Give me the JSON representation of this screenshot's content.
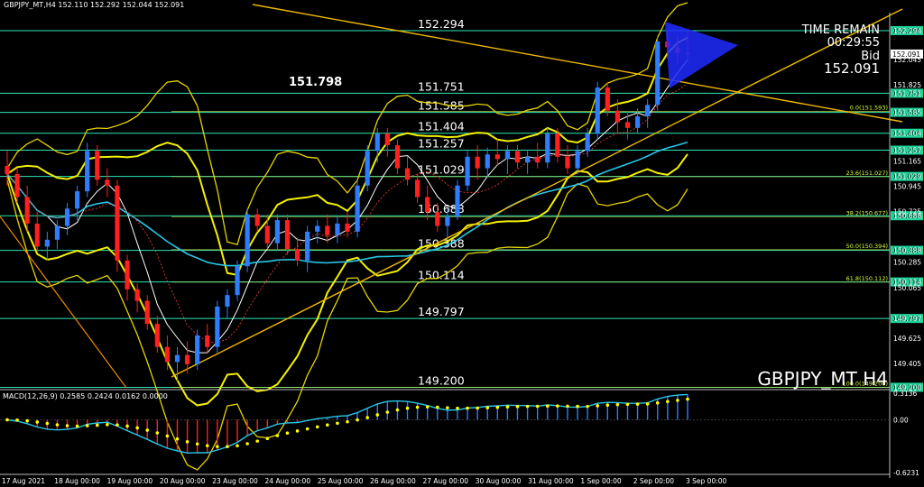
{
  "chart_data": {
    "type": "candlestick",
    "header": "GBPJPY_MT,H4  152.110 152.292 152.044 152.091",
    "symbol_label": "GBPJPY_MT H4",
    "timer": {
      "title": "TIME REMAIN",
      "countdown": "00:29:55",
      "bid_label": "Bid",
      "bid_value": "152.091"
    },
    "current_price": "152.091",
    "highlight_label": "151.798",
    "ylim": [
      149.18,
      152.45
    ],
    "ticks": [
      "152.294",
      "152.091",
      "152.045",
      "151.825",
      "151.751",
      "151.585",
      "151.404",
      "151.257",
      "151.165",
      "151.029",
      "150.945",
      "150.725",
      "150.688",
      "150.388",
      "150.285",
      "150.114",
      "150.065",
      "149.797",
      "149.625",
      "149.405",
      "149.200"
    ],
    "levels": [
      {
        "price": 152.294,
        "label": "152.294",
        "box": "152.294"
      },
      {
        "price": 151.751,
        "label": "151.751",
        "box": "151.751"
      },
      {
        "price": 151.585,
        "label": "151.585",
        "box": "151.585"
      },
      {
        "price": 151.404,
        "label": "151.404",
        "box": "151.404"
      },
      {
        "price": 151.257,
        "label": "151.257",
        "box": "151.257"
      },
      {
        "price": 151.029,
        "label": "151.029",
        "box": "151.029"
      },
      {
        "price": 150.688,
        "label": "150.688",
        "box": "150.688"
      },
      {
        "price": 150.388,
        "label": "150.388",
        "box": "150.388"
      },
      {
        "price": 150.114,
        "label": "150.114",
        "box": "150.114"
      },
      {
        "price": 149.797,
        "label": "149.797",
        "box": "149.797"
      },
      {
        "price": 149.2,
        "label": "149.200",
        "box": "149.200"
      }
    ],
    "fibo": [
      {
        "price": 151.593,
        "label": "0.0(151.593)"
      },
      {
        "price": 151.027,
        "label": "23.6(151.027)"
      },
      {
        "price": 150.677,
        "label": "38.2(150.677)"
      },
      {
        "price": 150.394,
        "label": "50.0(150.394)"
      },
      {
        "price": 150.112,
        "label": "61.8(150.112)"
      },
      {
        "price": 149.2,
        "label": "100.0(149.200)"
      }
    ],
    "dates": [
      "17 Aug 2021",
      "18 Aug 00:00",
      "19 Aug 00:00",
      "20 Aug 00:00",
      "23 Aug 00:00",
      "24 Aug 00:00",
      "25 Aug 00:00",
      "26 Aug 00:00",
      "27 Aug 00:00",
      "30 Aug 00:00",
      "31 Aug 00:00",
      "1 Sep 00:00",
      "2 Sep 00:00",
      "3 Sep 00:00"
    ],
    "candles": [
      [
        151.12,
        151.25,
        150.95,
        151.05
      ],
      [
        151.05,
        151.1,
        150.8,
        150.85
      ],
      [
        150.85,
        150.95,
        150.55,
        150.62
      ],
      [
        150.62,
        150.72,
        150.38,
        150.42
      ],
      [
        150.42,
        150.55,
        150.3,
        150.48
      ],
      [
        150.48,
        150.65,
        150.4,
        150.6
      ],
      [
        150.6,
        150.8,
        150.52,
        150.75
      ],
      [
        150.75,
        150.95,
        150.65,
        150.9
      ],
      [
        150.9,
        151.32,
        150.85,
        151.25
      ],
      [
        151.25,
        151.3,
        150.95,
        151.0
      ],
      [
        151.0,
        151.1,
        150.85,
        150.95
      ],
      [
        150.95,
        151.0,
        150.2,
        150.3
      ],
      [
        150.3,
        150.35,
        149.95,
        150.05
      ],
      [
        150.05,
        150.1,
        149.85,
        149.95
      ],
      [
        149.95,
        150.0,
        149.7,
        149.75
      ],
      [
        149.75,
        149.82,
        149.5,
        149.55
      ],
      [
        149.55,
        149.65,
        149.35,
        149.42
      ],
      [
        149.42,
        149.55,
        149.25,
        149.48
      ],
      [
        149.48,
        149.6,
        149.32,
        149.4
      ],
      [
        149.4,
        149.7,
        149.35,
        149.65
      ],
      [
        149.65,
        149.75,
        149.5,
        149.55
      ],
      [
        149.55,
        149.95,
        149.5,
        149.9
      ],
      [
        149.9,
        150.05,
        149.8,
        150.0
      ],
      [
        150.0,
        150.3,
        149.95,
        150.25
      ],
      [
        150.25,
        150.75,
        150.2,
        150.7
      ],
      [
        150.7,
        150.75,
        150.55,
        150.6
      ],
      [
        150.6,
        150.7,
        150.4,
        150.45
      ],
      [
        150.45,
        150.7,
        150.4,
        150.65
      ],
      [
        150.65,
        150.7,
        150.35,
        150.4
      ],
      [
        150.4,
        150.5,
        150.25,
        150.3
      ],
      [
        150.3,
        150.6,
        150.2,
        150.55
      ],
      [
        150.55,
        150.65,
        150.45,
        150.6
      ],
      [
        150.6,
        150.7,
        150.45,
        150.52
      ],
      [
        150.52,
        150.68,
        150.45,
        150.62
      ],
      [
        150.62,
        150.72,
        150.5,
        150.55
      ],
      [
        150.55,
        151.0,
        150.5,
        150.95
      ],
      [
        150.95,
        151.3,
        150.9,
        151.25
      ],
      [
        151.25,
        151.45,
        151.15,
        151.4
      ],
      [
        151.4,
        151.45,
        151.2,
        151.3
      ],
      [
        151.3,
        151.35,
        151.05,
        151.1
      ],
      [
        151.1,
        151.2,
        150.95,
        151.0
      ],
      [
        151.0,
        151.05,
        150.8,
        150.85
      ],
      [
        150.85,
        150.95,
        150.65,
        150.72
      ],
      [
        150.72,
        150.8,
        150.55,
        150.6
      ],
      [
        150.6,
        150.75,
        150.5,
        150.68
      ],
      [
        150.68,
        151.0,
        150.65,
        150.95
      ],
      [
        150.95,
        151.25,
        150.9,
        151.2
      ],
      [
        151.2,
        151.3,
        151.0,
        151.1
      ],
      [
        151.1,
        151.28,
        151.02,
        151.22
      ],
      [
        151.22,
        151.35,
        151.12,
        151.18
      ],
      [
        151.18,
        151.3,
        151.05,
        151.25
      ],
      [
        151.25,
        151.3,
        151.1,
        151.15
      ],
      [
        151.15,
        151.25,
        151.05,
        151.2
      ],
      [
        151.2,
        151.32,
        151.1,
        151.15
      ],
      [
        151.15,
        151.45,
        151.1,
        151.4
      ],
      [
        151.4,
        151.45,
        151.15,
        151.2
      ],
      [
        151.2,
        151.3,
        151.05,
        151.1
      ],
      [
        151.1,
        151.3,
        151.05,
        151.25
      ],
      [
        151.25,
        151.45,
        151.2,
        151.4
      ],
      [
        151.4,
        151.85,
        151.35,
        151.8
      ],
      [
        151.8,
        151.85,
        151.55,
        151.6
      ],
      [
        151.6,
        151.7,
        151.4,
        151.5
      ],
      [
        151.5,
        151.6,
        151.35,
        151.45
      ],
      [
        151.45,
        151.62,
        151.4,
        151.55
      ],
      [
        151.55,
        151.7,
        151.45,
        151.65
      ],
      [
        151.65,
        152.25,
        151.6,
        152.2
      ],
      [
        152.2,
        152.3,
        152.05,
        152.15
      ],
      [
        152.15,
        152.25,
        152.0,
        152.1
      ],
      [
        152.1,
        152.29,
        152.04,
        152.09
      ]
    ],
    "macd": {
      "label": "MACD(12,26,9) 0.2585 0.2424 0.0162 0.0000",
      "ticks": [
        "0.3136",
        "0.00",
        "-0.6231"
      ]
    }
  }
}
